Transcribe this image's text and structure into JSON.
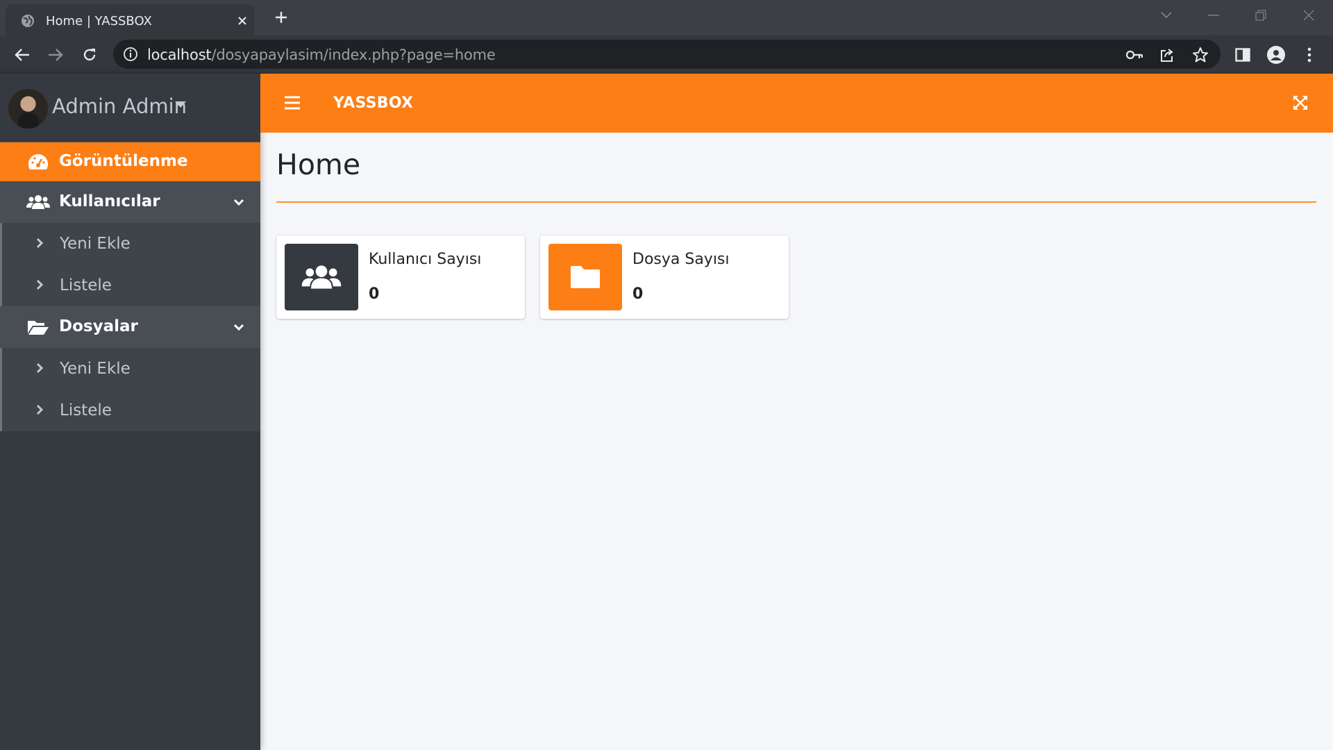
{
  "browser": {
    "tab_title": "Home | YASSBOX",
    "url_host": "localhost",
    "url_path": "/dosyapaylasim/index.php?page=home"
  },
  "sidebar": {
    "user_name": "Admin Admin",
    "items": [
      {
        "label": "Görüntülenme",
        "icon": "dashboard-gauge-icon",
        "active": true
      },
      {
        "label": "Kullanıcılar",
        "icon": "users-icon",
        "open": true,
        "children": [
          {
            "label": "Yeni Ekle"
          },
          {
            "label": "Listele"
          }
        ]
      },
      {
        "label": "Dosyalar",
        "icon": "folder-open-icon",
        "open": true,
        "children": [
          {
            "label": "Yeni Ekle"
          },
          {
            "label": "Listele"
          }
        ]
      }
    ]
  },
  "topbar": {
    "brand": "YASSBOX"
  },
  "main": {
    "title": "Home",
    "info_boxes": [
      {
        "label": "Kullanıcı Sayısı",
        "value": "0",
        "icon": "users-icon",
        "color": "#343a40"
      },
      {
        "label": "Dosya Sayısı",
        "value": "0",
        "icon": "folder-icon",
        "color": "#fd7e14"
      }
    ]
  },
  "colors": {
    "accent": "#fd7e14",
    "sidebar": "#343a40",
    "background": "#f4f6f9"
  }
}
